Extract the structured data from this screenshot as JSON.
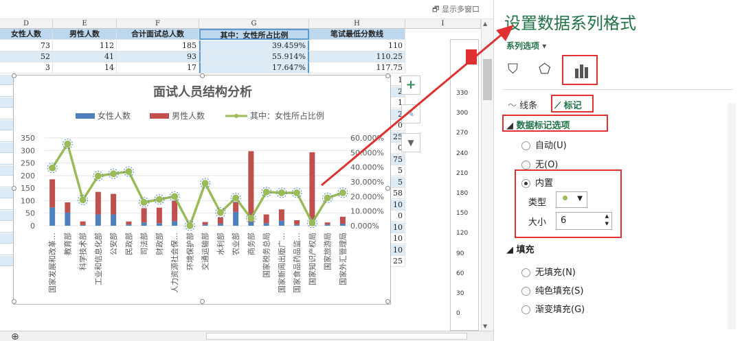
{
  "sheet": {
    "multiwindow_label": "显示多窗口",
    "col_letters": [
      "D",
      "E",
      "F",
      "G",
      "H",
      "I"
    ],
    "headers": [
      "女性人数",
      "男性人数",
      "合计面试总人数",
      "其中：女性所占比例",
      "笔试最低分数线"
    ],
    "rows": [
      [
        "73",
        "112",
        "185",
        "39.459%",
        "110"
      ],
      [
        "52",
        "41",
        "93",
        "55.914%",
        "110.25"
      ],
      [
        "3",
        "14",
        "17",
        "17.647%",
        "117.75"
      ]
    ],
    "right_col_fragments": [
      "1",
      "2",
      "1",
      "2",
      "0",
      "25",
      "0",
      "75",
      "5",
      "5",
      "58",
      "10",
      "0",
      "10",
      "10",
      "10",
      "25"
    ]
  },
  "chart": {
    "title": "面试人员结构分析",
    "legend": [
      "女性人数",
      "男性人数",
      "其中：女性所占比例"
    ],
    "colors": {
      "female": "#4e81bd",
      "male": "#c0504d",
      "ratio": "#9bbb59"
    },
    "y_left_ticks": [
      "350",
      "300",
      "250",
      "200",
      "150",
      "100",
      "50",
      "0"
    ],
    "y_right_ticks": [
      "60.000%",
      "50.000%",
      "40.000%",
      "30.000%",
      "20.000%",
      "10.000%",
      "0.000%"
    ],
    "side_buttons": [
      "+",
      "✎",
      "▼"
    ]
  },
  "chart_data": {
    "type": "bar",
    "title": "面试人员结构分析",
    "categories": [
      "国家发展和改革…",
      "教育部",
      "科学技术部",
      "工业和信息化部",
      "公安部",
      "民政部",
      "司法部",
      "财政部",
      "人力资源社会保…",
      "环境保护部",
      "交通运输部",
      "水利部",
      "农业部",
      "商务部",
      "国家税务总局",
      "国家新闻出版广…",
      "国家食品药品监…",
      "国家知识产权局",
      "国家旅游局",
      "国家外汇管理局"
    ],
    "ylim": [
      0,
      350
    ],
    "y2lim": [
      0,
      0.6
    ],
    "series": [
      {
        "name": "女性人数",
        "stack": true,
        "values": [
          73,
          52,
          3,
          45,
          45,
          5,
          13,
          10,
          18,
          2,
          5,
          8,
          55,
          15,
          10,
          20,
          5,
          5,
          5,
          8
        ]
      },
      {
        "name": "男性人数",
        "stack": true,
        "values": [
          112,
          41,
          14,
          90,
          82,
          12,
          57,
          62,
          82,
          2,
          10,
          25,
          40,
          282,
          35,
          45,
          17,
          288,
          8,
          28
        ]
      },
      {
        "name": "其中：女性所占比例",
        "axis": "right",
        "values": [
          0.39459,
          0.55914,
          0.17647,
          0.34,
          0.355,
          0.37,
          0.16,
          0.18,
          0.2,
          0.0,
          0.29,
          0.09,
          0.19,
          0.05,
          0.23,
          0.225,
          0.225,
          0.02,
          0.19,
          0.225
        ]
      }
    ]
  },
  "inner_axis": {
    "ticks": [
      "330",
      "300",
      "270",
      "240",
      "210",
      "180",
      "150",
      "120",
      "90",
      "60",
      "30",
      "0"
    ]
  },
  "pane": {
    "title": "设置数据系列格式",
    "series_options": "系列选项",
    "tab_line": "线条",
    "tab_marker": "标记",
    "section_marker_options": "数据标记选项",
    "auto": "自动(U)",
    "none": "无(O)",
    "builtin": "内置",
    "type_label": "类型",
    "size_label": "大小",
    "size_value": "6",
    "section_fill": "填充",
    "no_fill": "无填充(N)",
    "solid_fill": "纯色填充(S)",
    "gradient_fill": "渐变填充(G)"
  }
}
